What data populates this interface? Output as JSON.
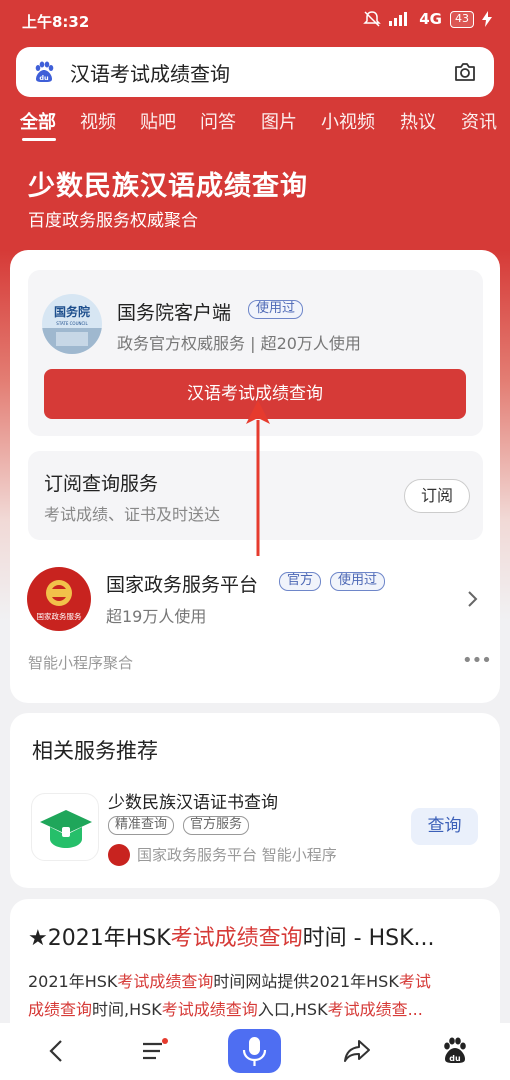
{
  "status_bar": {
    "time": "上午8:32",
    "network": "4G",
    "battery": "43"
  },
  "search": {
    "query": "汉语考试成绩查询"
  },
  "tabs": [
    "全部",
    "视频",
    "贴吧",
    "问答",
    "图片",
    "小视频",
    "热议",
    "资讯"
  ],
  "hero": {
    "title": "少数民族汉语成绩查询",
    "subtitle": "百度政务服务权威聚合"
  },
  "gov_card": {
    "logo_text": "国务院",
    "logo_sub": "STATE COUNCIL",
    "name": "国务院客户端",
    "tag": "使用过",
    "desc": "政务官方权威服务 | 超20万人使用",
    "button": "汉语考试成绩查询"
  },
  "subscribe": {
    "title": "订阅查询服务",
    "desc": "考试成绩、证书及时送达",
    "button": "订阅"
  },
  "national": {
    "logo_text": "国家政务服务",
    "name": "国家政务服务平台",
    "tag_official": "官方",
    "tag_used": "使用过",
    "users": "超19万人使用"
  },
  "mini_program_label": "智能小程序聚合",
  "related": {
    "title": "相关服务推荐",
    "item_name": "少数民族汉语证书查询",
    "tag1": "精准查询",
    "tag2": "官方服务",
    "source": "国家政务服务平台  智能小程序",
    "button": "查询"
  },
  "result": {
    "title_prefix": "★2021年HSK",
    "title_hl": "考试成绩查询",
    "title_suffix": "时间 - HSK...",
    "line1_a": "2021年HSK",
    "line1_hl": "考试成绩查询",
    "line1_b": "时间网站提供2021年HSK",
    "line1_hl2": "考试",
    "line2_hl": "成绩查询",
    "line2_a": "时间,HSK",
    "line2_hl2": "考试成绩查询",
    "line2_b": "入口,HSK",
    "line2_hl3": "考试成绩查..."
  },
  "colors": {
    "brand_red": "#d63a37",
    "accent_blue": "#4e6ef2"
  }
}
